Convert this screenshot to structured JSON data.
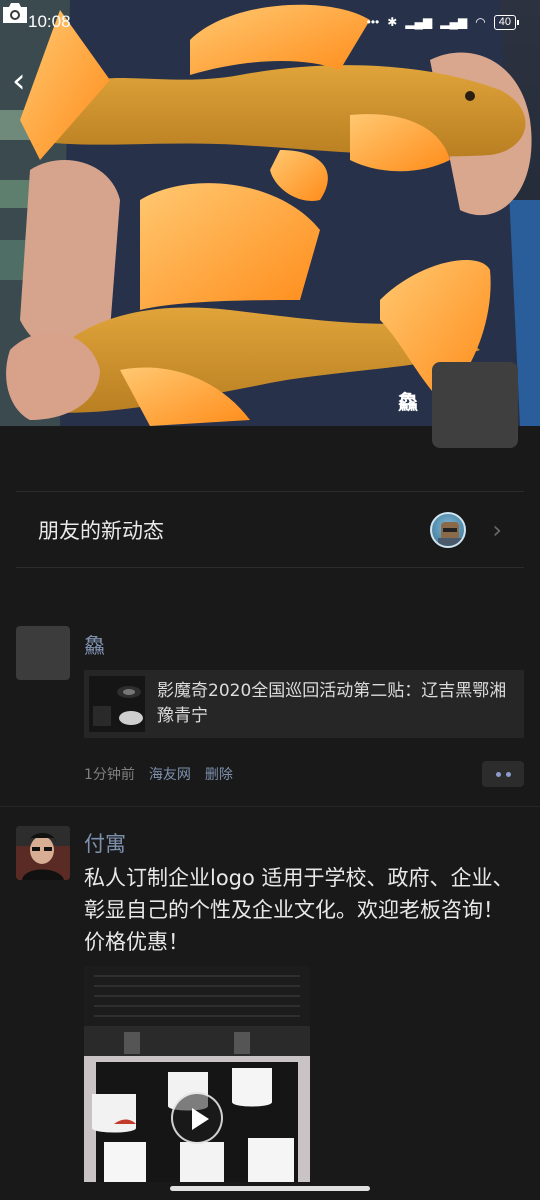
{
  "status_bar": {
    "time": "10:08",
    "battery": "40"
  },
  "cover": {
    "owner_name": "鱻"
  },
  "friends_updates": {
    "label": "朋友的新动态"
  },
  "posts": [
    {
      "author": "鱻",
      "share_title": "影魔奇2020全国巡回活动第二贴：辽吉黑鄂湘豫青宁",
      "time": "1分钟前",
      "source": "海友网",
      "delete_label": "删除"
    },
    {
      "author": "付寓",
      "text": "私人订制企业logo 适用于学校、政府、企业、彰显自己的个性及企业文化。欢迎老板咨询！价格优惠！"
    }
  ],
  "colors": {
    "background": "#191919",
    "link": "#7d90ad",
    "card": "#262626"
  },
  "icons": [
    "back-icon",
    "camera-icon",
    "chevron-right-icon",
    "more-icon",
    "play-icon"
  ]
}
